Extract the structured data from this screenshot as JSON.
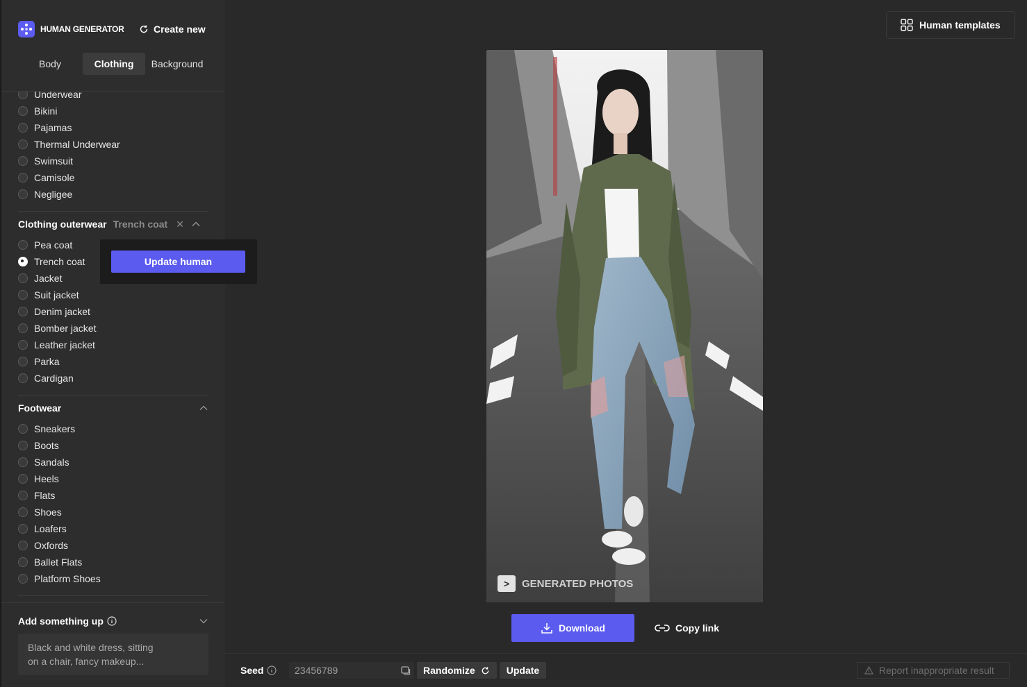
{
  "brand": {
    "name": "HUMAN GENERATOR",
    "create_new": "Create new"
  },
  "tabs": [
    {
      "label": "Body"
    },
    {
      "label": "Clothing"
    },
    {
      "label": "Background"
    }
  ],
  "active_tab": "Clothing",
  "underwear_options": [
    "Underwear",
    "Bikini",
    "Pajamas",
    "Thermal Underwear",
    "Swimsuit",
    "Camisole",
    "Negligee"
  ],
  "outerwear": {
    "title": "Clothing outerwear",
    "selected": "Trench coat",
    "options": [
      "Pea coat",
      "Trench coat",
      "Jacket",
      "Suit jacket",
      "Denim jacket",
      "Bomber jacket",
      "Leather jacket",
      "Parka",
      "Cardigan"
    ]
  },
  "footwear": {
    "title": "Footwear",
    "options": [
      "Sneakers",
      "Boots",
      "Sandals",
      "Heels",
      "Flats",
      "Shoes",
      "Loafers",
      "Oxfords",
      "Ballet Flats",
      "Platform Shoes"
    ]
  },
  "popup": {
    "button": "Update human"
  },
  "add_something": {
    "title": "Add something up",
    "placeholder_line1": "Black and white dress, sitting",
    "placeholder_line2": "on a chair, fancy makeup..."
  },
  "header": {
    "templates_button": "Human templates"
  },
  "image": {
    "watermark": "GENERATED PHOTOS",
    "watermark_mark": ">"
  },
  "actions": {
    "download": "Download",
    "copy_link": "Copy link"
  },
  "seed": {
    "label": "Seed",
    "value": "23456789",
    "randomize": "Randomize",
    "update": "Update"
  },
  "report": "Report inappropriate result",
  "colors": {
    "accent": "#5b5bf0",
    "background": "#292929",
    "sidebar": "#2d2d2d"
  },
  "icons": [
    "refresh-icon",
    "info-icon",
    "chevron-up-icon",
    "chevron-down-icon",
    "close-icon",
    "grid-icon",
    "download-icon",
    "link-icon",
    "copy-icon",
    "warning-icon"
  ]
}
